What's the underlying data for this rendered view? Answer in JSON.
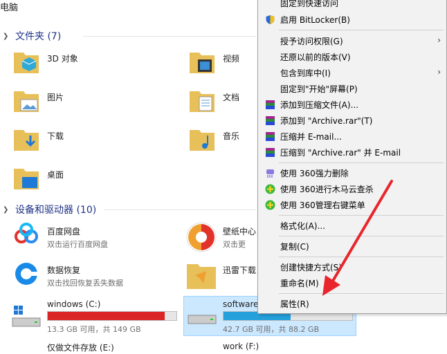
{
  "breadcrumb": "电脑",
  "groups": {
    "folders": "文件夹 (7)",
    "devices": "设备和驱动器 (10)"
  },
  "folders": {
    "f3d": "3D 对象",
    "video": "视频",
    "pictures": "图片",
    "documents": "文档",
    "downloads": "下载",
    "music": "音乐",
    "desktop": "桌面"
  },
  "devices": {
    "baidu": {
      "name": "百度网盘",
      "desc": "双击运行百度网盘"
    },
    "wallpaper": {
      "name": "壁纸中心",
      "desc": "双击更"
    },
    "recovery": {
      "name": "数据恢复",
      "desc": "双击找回恢复丢失数据"
    },
    "xunlei": {
      "name": "迅雷下载"
    },
    "c": {
      "name": "windows (C:)",
      "space": "13.3 GB 可用，共 149 GB",
      "used_fraction": 0.91,
      "color": "#da2626"
    },
    "d": {
      "name": "software",
      "space": "42.7 GB 可用，共 88.2 GB",
      "used_fraction": 0.52,
      "color": "#26a0da"
    },
    "e": {
      "name": "仅做文件存放 (E:)"
    },
    "f": {
      "name": "work (F:)"
    }
  },
  "menu": {
    "pin_quick": "固定到快速访问",
    "bitlocker": "启用 BitLocker(B)",
    "grant": "授予访问权限(G)",
    "restore": "还原以前的版本(V)",
    "include": "包含到库中(I)",
    "pin_start": "固定到\"开始\"屏幕(P)",
    "add_archive": "添加到压缩文件(A)...",
    "add_rar": "添加到 \"Archive.rar\"(T)",
    "zip_email": "压缩并 E-mail...",
    "zip_rar_email": "压缩到 \"Archive.rar\" 并 E-mail",
    "shred360": "使用 360强力删除",
    "scan360": "使用 360进行木马云查杀",
    "manage360": "使用 360管理右键菜单",
    "format": "格式化(A)...",
    "copy": "复制(C)",
    "shortcut": "创建快捷方式(S)",
    "rename": "重命名(M)",
    "properties": "属性(R)"
  },
  "colors": {
    "accent": "#1e3287",
    "annotation_arrow": "#e8262c"
  }
}
